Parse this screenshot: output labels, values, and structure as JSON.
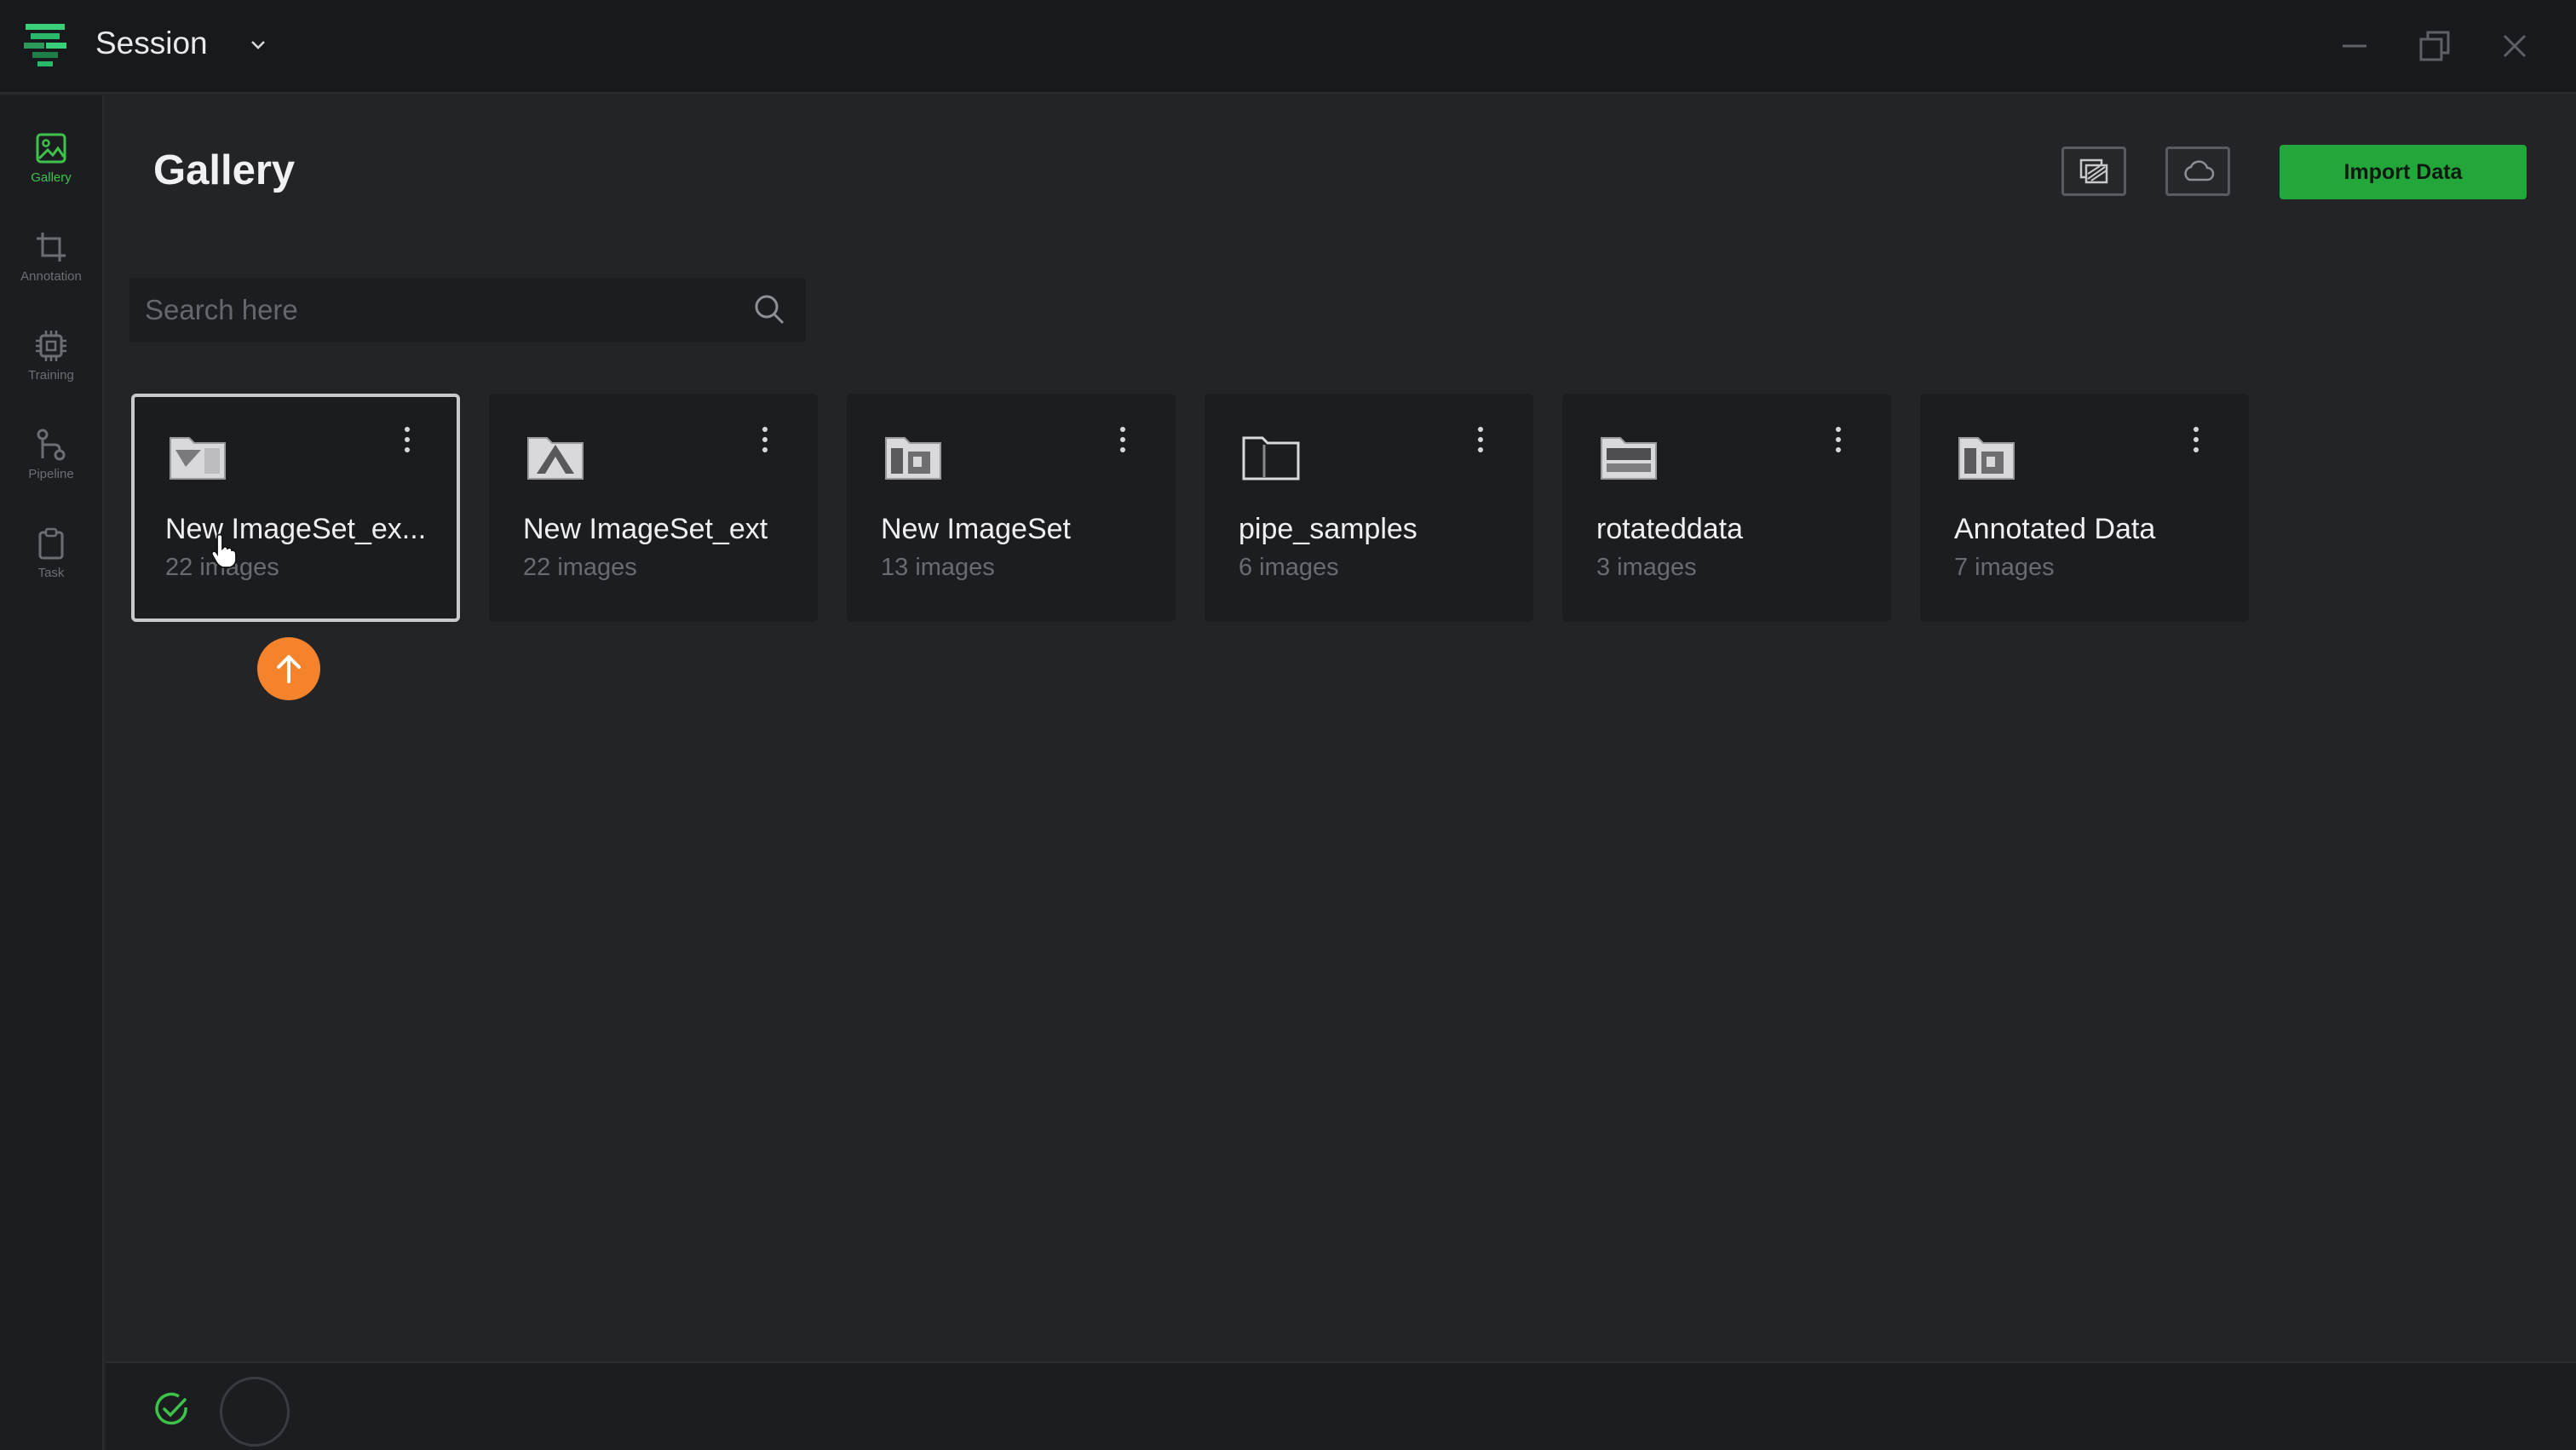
{
  "titlebar": {
    "session_label": "Session",
    "logo_icon": "app-logo-icon",
    "dropdown_icon": "chevron-down-icon"
  },
  "sidebar": {
    "items": [
      {
        "label": "Gallery",
        "icon": "image-icon",
        "active": true
      },
      {
        "label": "Annotation",
        "icon": "crop-icon",
        "active": false
      },
      {
        "label": "Training",
        "icon": "chip-icon",
        "active": false
      },
      {
        "label": "Pipeline",
        "icon": "pipeline-icon",
        "active": false
      },
      {
        "label": "Task",
        "icon": "clipboard-icon",
        "active": false
      }
    ]
  },
  "header": {
    "title": "Gallery",
    "import_label": "Import Data"
  },
  "search": {
    "placeholder": "Search here",
    "value": ""
  },
  "datasets": [
    {
      "name": "New ImageSet_ex...",
      "count": "22 images",
      "selected": true
    },
    {
      "name": "New ImageSet_ext",
      "count": "22 images",
      "selected": false
    },
    {
      "name": "New ImageSet",
      "count": "13 images",
      "selected": false
    },
    {
      "name": "pipe_samples",
      "count": "6 images",
      "selected": false
    },
    {
      "name": "rotateddata",
      "count": "3 images",
      "selected": false
    },
    {
      "name": "Annotated Data",
      "count": "7 images",
      "selected": false
    }
  ],
  "colors": {
    "accent_green": "#23a73a",
    "upload_orange": "#f5832b",
    "active_nav": "#3fc24a"
  }
}
